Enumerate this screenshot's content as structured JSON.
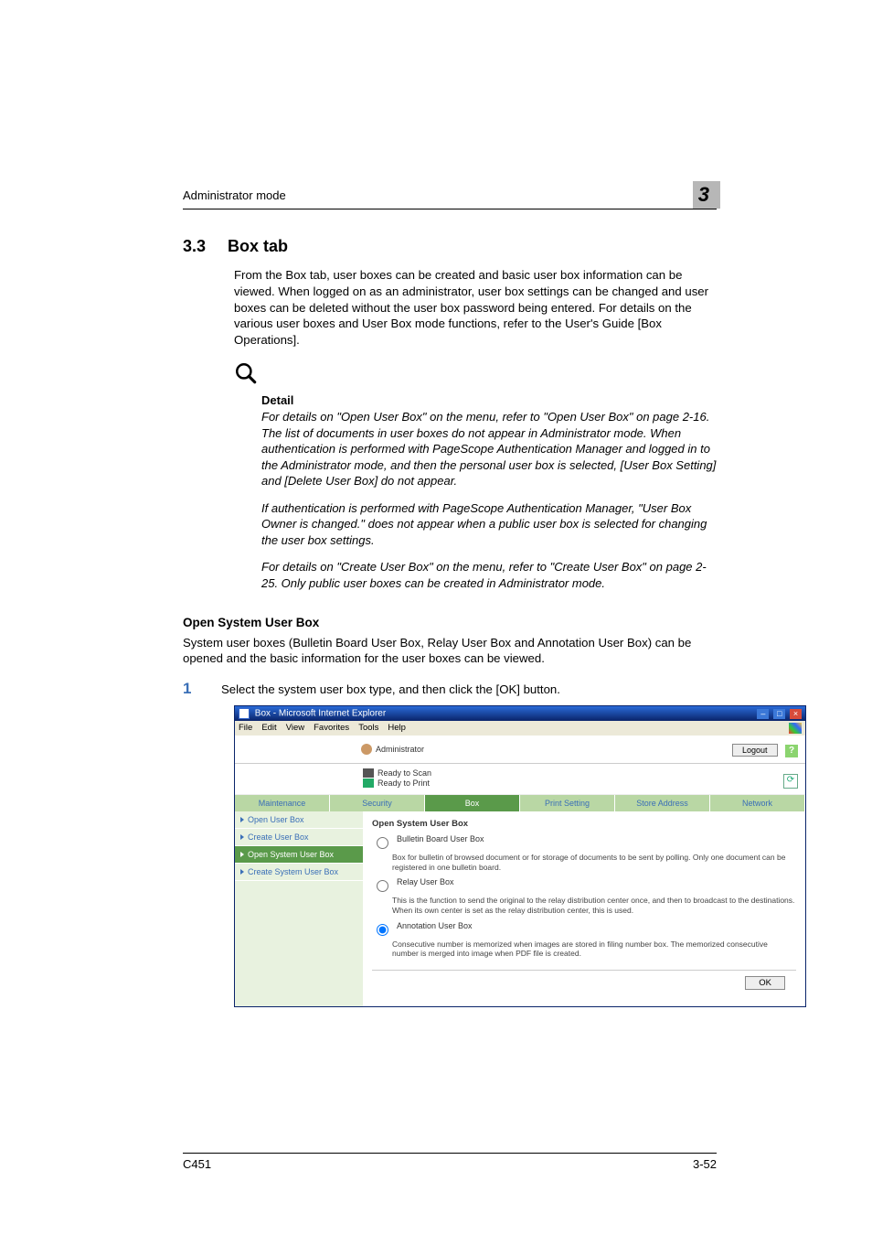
{
  "header": {
    "running_title": "Administrator mode",
    "chapter_number": "3"
  },
  "section": {
    "number": "3.3",
    "title": "Box tab",
    "intro": "From the Box tab, user boxes can be created and basic user box information can be viewed. When logged on as an administrator, user box settings can be changed and user boxes can be deleted without the user box password being entered. For details on the various user boxes and User Box mode functions, refer to the User's Guide [Box Operations]."
  },
  "detail": {
    "label": "Detail",
    "para1": "For details on \"Open User Box\" on the menu, refer to \"Open User Box\" on page 2-16. The list of documents in user boxes do not appear in Administrator mode. When authentication is performed with PageScope Authentication Manager and logged in to the Administrator mode, and then the personal user box is selected, [User Box Setting] and [Delete User Box] do not appear.",
    "para2": "If authentication is performed with PageScope Authentication Manager, \"User Box Owner is changed.\" does not appear when a public user box is selected for changing the user box settings.",
    "para3": "For details on \"Create User Box\" on the menu, refer to \"Create User Box\" on page 2-25. Only public user boxes can be created in Administrator mode."
  },
  "subsection": {
    "title": "Open System User Box",
    "text": "System user boxes (Bulletin Board User Box, Relay User Box and Annotation User Box) can be opened and the basic information for the user boxes can be viewed."
  },
  "step": {
    "number": "1",
    "text": "Select the system user box type, and then click the [OK] button."
  },
  "screenshot": {
    "window_title": "Box - Microsoft Internet Explorer",
    "menu": [
      "File",
      "Edit",
      "View",
      "Favorites",
      "Tools",
      "Help"
    ],
    "admin_label": "Administrator",
    "logout": "Logout",
    "status_scan": "Ready to Scan",
    "status_print": "Ready to Print",
    "tabs": [
      "Maintenance",
      "Security",
      "Box",
      "Print Setting",
      "Store Address",
      "Network"
    ],
    "active_tab_index": 2,
    "sidebar": [
      {
        "label": "Open User Box"
      },
      {
        "label": "Create User Box"
      },
      {
        "label": "Open System User Box"
      },
      {
        "label": "Create System User Box"
      }
    ],
    "active_sidebar_index": 2,
    "panel_title": "Open System User Box",
    "options": [
      {
        "label": "Bulletin Board User Box",
        "desc": "Box for bulletin of browsed document or for storage of documents to be sent by polling. Only one document can be registered in one bulletin board.",
        "checked": false
      },
      {
        "label": "Relay User Box",
        "desc": "This is the function to send the original to the relay distribution center once, and then to broadcast to the destinations. When its own center is set as the relay distribution center, this is used.",
        "checked": false
      },
      {
        "label": "Annotation User Box",
        "desc": "Consecutive number is memorized when images are stored in filing number box. The memorized consecutive number is merged into image when PDF file is created.",
        "checked": true
      }
    ],
    "ok_label": "OK"
  },
  "footer": {
    "model": "C451",
    "page": "3-52"
  }
}
